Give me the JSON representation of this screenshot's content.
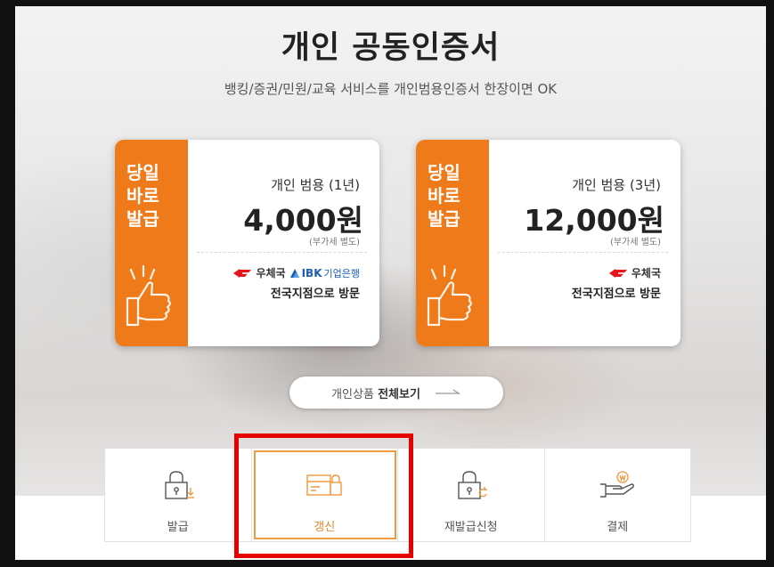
{
  "header": {
    "title": "개인 공동인증서",
    "subtitle": "뱅킹/증권/민원/교육 서비스를 개인범용인증서 한장이면 OK"
  },
  "cards": [
    {
      "badge": [
        "당일",
        "바로",
        "발급"
      ],
      "plan": "개인 범용 (1년)",
      "price": "4,000원",
      "vat": "(부가세 별도)",
      "post_label": "우체국",
      "bank_name": "IBK",
      "bank_suffix": "기업은행",
      "visit": "전국지점으로 방문"
    },
    {
      "badge": [
        "당일",
        "바로",
        "발급"
      ],
      "plan": "개인 범용 (3년)",
      "price": "12,000원",
      "vat": "(부가세 별도)",
      "post_label": "우체국",
      "visit": "전국지점으로 방문"
    }
  ],
  "all_products": {
    "prefix": "개인상품",
    "bold": "전체보기"
  },
  "services": [
    {
      "label": "발급",
      "icon": "lock-download-icon",
      "active": false
    },
    {
      "label": "갱신",
      "icon": "card-lock-icon",
      "active": true
    },
    {
      "label": "재발급신청",
      "icon": "lock-refresh-icon",
      "active": false
    },
    {
      "label": "결제",
      "icon": "hand-coin-icon",
      "active": false
    }
  ],
  "colors": {
    "accent": "#ee7a1a",
    "highlight": "#e60000",
    "text": "#222222"
  }
}
